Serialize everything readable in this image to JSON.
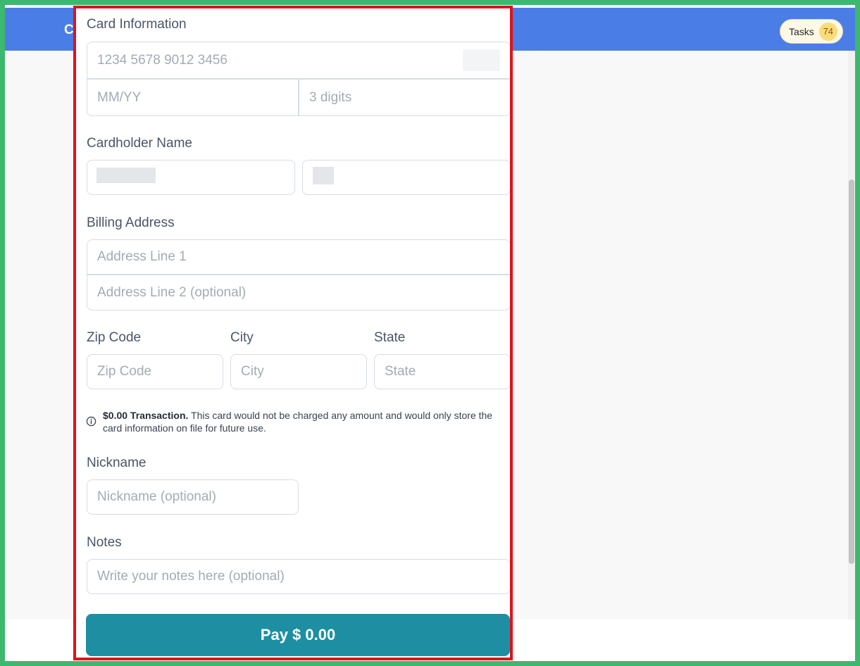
{
  "header": {
    "brand_initial": "C",
    "tasks_label": "Tasks",
    "tasks_count": "74"
  },
  "form": {
    "card_info_label": "Card Information",
    "card_number_placeholder": "1234 5678 9012 3456",
    "expiry_placeholder": "MM/YY",
    "cvc_placeholder": "3 digits",
    "cardholder_label": "Cardholder Name",
    "billing_label": "Billing Address",
    "address1_placeholder": "Address Line 1",
    "address2_placeholder": "Address Line 2 (optional)",
    "zip_label": "Zip Code",
    "zip_placeholder": "Zip Code",
    "city_label": "City",
    "city_placeholder": "City",
    "state_label": "State",
    "state_placeholder": "State",
    "notice_bold": "$0.00 Transaction.",
    "notice_text": "This card would not be charged any amount and would only store the card information on file for future use.",
    "nickname_label": "Nickname",
    "nickname_placeholder": "Nickname (optional)",
    "notes_label": "Notes",
    "notes_placeholder": "Write your notes here (optional)",
    "pay_label": "Pay $ 0.00"
  },
  "colors": {
    "header_bg": "#4a7de6",
    "pay_button": "#1e8fa3",
    "panel_border": "#e0121b",
    "frame_border": "#3db86e"
  }
}
